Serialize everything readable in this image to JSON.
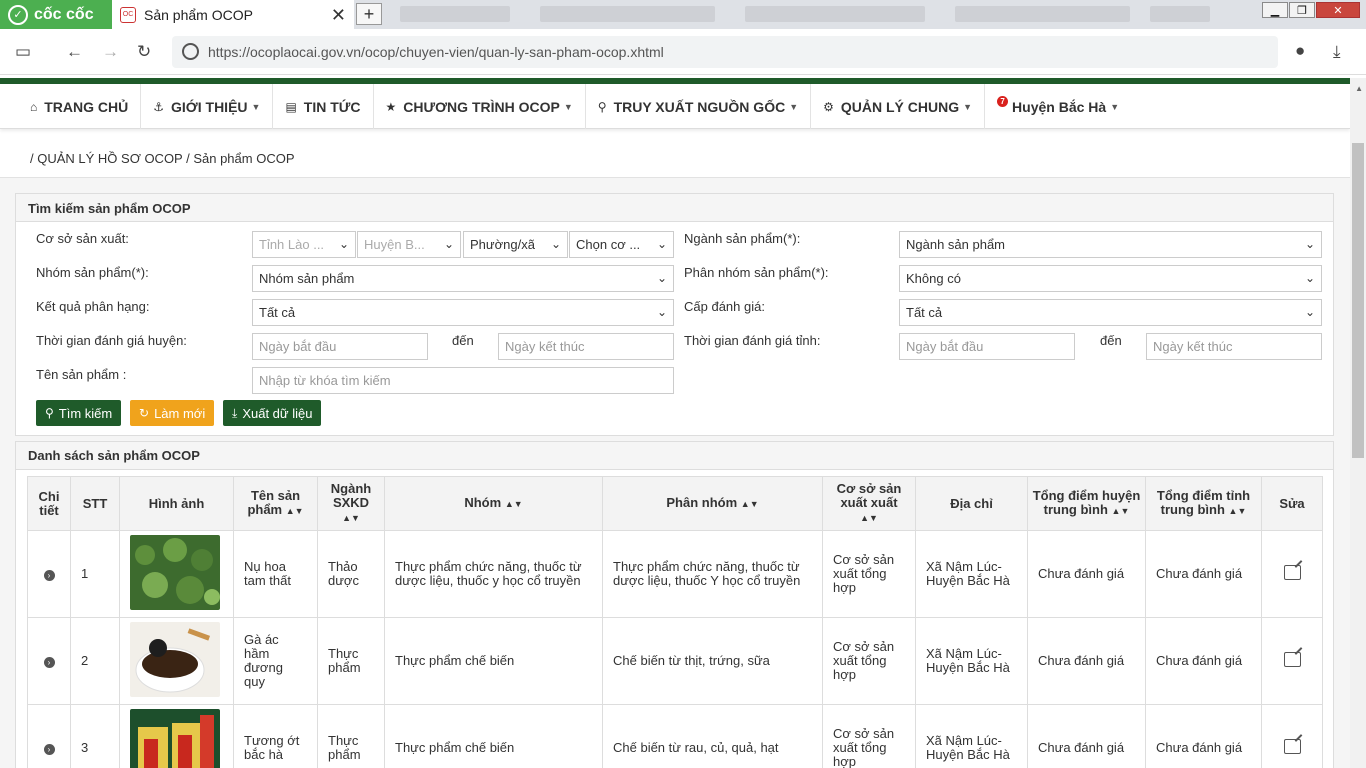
{
  "browser": {
    "brand": "cốc cốc",
    "active_tab_title": "Sản phẩm OCOP",
    "new_tab": "+",
    "url": "https://ocoplaocai.gov.vn/ocop/chuyen-vien/quan-ly-san-pham-ocop.xhtml"
  },
  "nav": {
    "items": [
      {
        "label": "TRANG CHỦ",
        "icon": "home-icon",
        "dropdown": false
      },
      {
        "label": "GIỚI THIỆU",
        "icon": "anchor-icon",
        "dropdown": true
      },
      {
        "label": "TIN TỨC",
        "icon": "newspaper-icon",
        "dropdown": false
      },
      {
        "label": "CHƯƠNG TRÌNH OCOP",
        "icon": "star-icon",
        "dropdown": true
      },
      {
        "label": "TRUY XUẤT NGUỒN GỐC",
        "icon": "search-icon",
        "dropdown": true
      },
      {
        "label": "QUẢN LÝ CHUNG",
        "icon": "gear-icon",
        "dropdown": true
      }
    ],
    "user": {
      "label": "Huyện Bắc Hà",
      "badge": "7"
    }
  },
  "breadcrumb": "/ QUẢN LÝ HỒ SƠ OCOP / Sản phẩm OCOP",
  "search": {
    "title": "Tìm kiếm sản phẩm OCOP",
    "labels": {
      "co_so": "Cơ sở sản xuất:",
      "nganh": "Ngành sản phẩm(*):",
      "nhom": "Nhóm sản phẩm(*):",
      "phan_nhom": "Phân nhóm sản phẩm(*):",
      "ket_qua": "Kết quả phân hạng:",
      "cap": "Cấp đánh giá:",
      "tg_huyen": "Thời gian đánh giá huyện:",
      "tg_tinh": "Thời gian đánh giá tỉnh:",
      "ten": "Tên sản phẩm :",
      "den": "đến"
    },
    "values": {
      "tinh": "Tỉnh Lào ...",
      "huyen": "Huyện B...",
      "phuong": "Phường/xã",
      "co_so": "Chọn cơ ...",
      "nganh": "Ngành sản phẩm",
      "nhom": "Nhóm sản phẩm",
      "phan_nhom": "Không có",
      "ket_qua": "Tất cả",
      "cap": "Tất cả"
    },
    "placeholders": {
      "start": "Ngày bắt đầu",
      "end": "Ngày kết thúc",
      "keyword": "Nhập từ khóa tìm kiếm"
    },
    "buttons": {
      "search": "Tìm kiếm",
      "reset": "Làm mới",
      "export": "Xuất dữ liệu"
    }
  },
  "list": {
    "title": "Danh sách sản phẩm OCOP",
    "columns": [
      "Chi tiết",
      "STT",
      "Hình ảnh",
      "Tên sản phẩm",
      "Ngành SXKD",
      "Nhóm",
      "Phân nhóm",
      "Cơ sở sản xuất xuất",
      "Địa chỉ",
      "Tổng điểm huyện trung bình",
      "Tổng điểm tỉnh trung bình",
      "Sửa"
    ],
    "rows": [
      {
        "stt": "1",
        "ten": "Nụ hoa tam thất",
        "nganh": "Thảo dược",
        "nhom": "Thực phẩm chức năng, thuốc từ dược liệu, thuốc y học cổ truyền",
        "phan_nhom": "Thực phẩm chức năng, thuốc từ dược liệu, thuốc Y học cổ truyền",
        "co_so": "Cơ sở sản xuất tổng hợp",
        "dia_chi": "Xã Nậm Lúc-Huyện Bắc Hà",
        "diem_huyen": "Chưa đánh giá",
        "diem_tinh": "Chưa đánh giá"
      },
      {
        "stt": "2",
        "ten": "Gà ác hầm đương quy",
        "nganh": "Thực phẩm",
        "nhom": "Thực phẩm chế biến",
        "phan_nhom": "Chế biến từ thịt, trứng, sữa",
        "co_so": "Cơ sở sản xuất tổng hợp",
        "dia_chi": "Xã Nậm Lúc-Huyện Bắc Hà",
        "diem_huyen": "Chưa đánh giá",
        "diem_tinh": "Chưa đánh giá"
      },
      {
        "stt": "3",
        "ten": "Tương ớt bắc hà",
        "nganh": "Thực phẩm",
        "nhom": "Thực phẩm chế biến",
        "phan_nhom": "Chế biến từ rau, củ, quả, hạt",
        "co_so": "Cơ sở sản xuất tổng hợp",
        "dia_chi": "Xã Nậm Lúc-Huyện Bắc Hà",
        "diem_huyen": "Chưa đánh giá",
        "diem_tinh": "Chưa đánh giá"
      }
    ]
  },
  "colors": {
    "primary_green": "#1f5b2a",
    "orange": "#f0a31c",
    "brand_green": "#4caf50"
  }
}
